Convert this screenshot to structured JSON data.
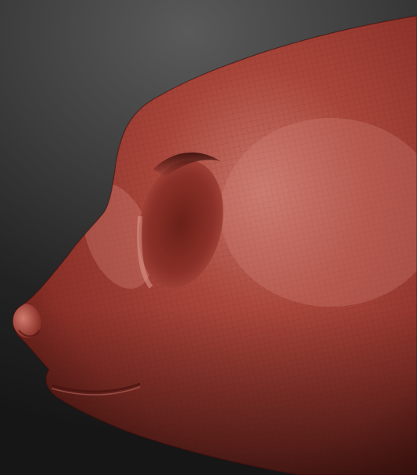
{
  "scene": {
    "subject": "sculpted-animal-head-side-view",
    "colors": {
      "background_light": "#5a5a5a",
      "background_dark": "#161616",
      "clay_base": "#9a3a30",
      "clay_highlight": "#d88a7e",
      "clay_shadow": "#4a1410",
      "wireframe": "#6e2a22"
    }
  }
}
